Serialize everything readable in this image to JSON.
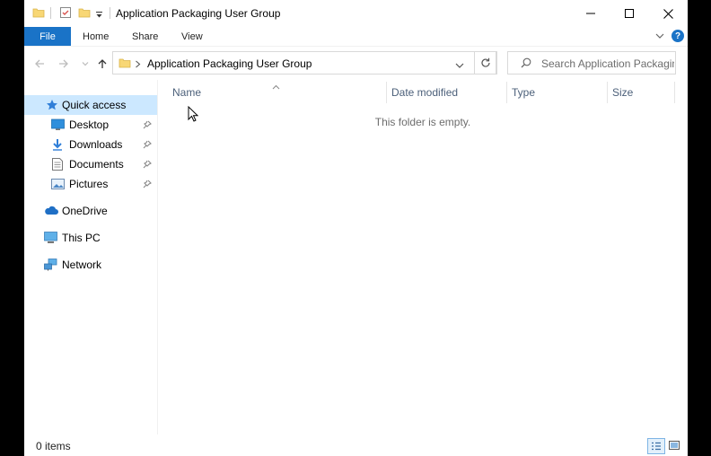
{
  "window": {
    "title": "Application Packaging User Group"
  },
  "ribbon": {
    "file": "File",
    "home": "Home",
    "share": "Share",
    "view": "View",
    "help": "?"
  },
  "address": {
    "path_item": "Application Packaging User Group"
  },
  "search": {
    "placeholder": "Search Application Packagin..."
  },
  "sidebar": {
    "items": [
      {
        "label": "Quick access",
        "icon": "star-icon"
      },
      {
        "label": "Desktop",
        "icon": "desktop-icon",
        "pinned": true
      },
      {
        "label": "Downloads",
        "icon": "download-icon",
        "pinned": true
      },
      {
        "label": "Documents",
        "icon": "document-icon",
        "pinned": true
      },
      {
        "label": "Pictures",
        "icon": "pictures-icon",
        "pinned": true
      },
      {
        "label": "OneDrive",
        "icon": "cloud-icon"
      },
      {
        "label": "This PC",
        "icon": "computer-icon"
      },
      {
        "label": "Network",
        "icon": "network-icon"
      }
    ]
  },
  "columns": {
    "name": "Name",
    "date_modified": "Date modified",
    "type": "Type",
    "size": "Size"
  },
  "content": {
    "empty_message": "This folder is empty."
  },
  "status": {
    "items": "0 items"
  },
  "colors": {
    "accent": "#1a73c7",
    "selection": "#cce8ff",
    "folder": "#f8d775"
  }
}
